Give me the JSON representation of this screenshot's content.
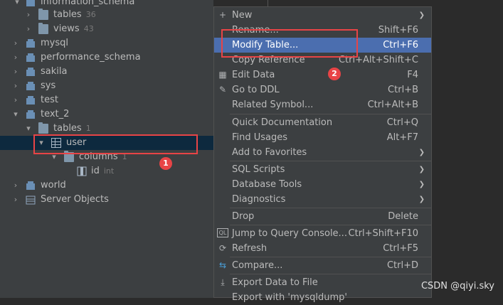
{
  "tree": {
    "items": [
      {
        "label": "information_schema",
        "count": ""
      },
      {
        "label": "tables",
        "count": "36"
      },
      {
        "label": "views",
        "count": "43"
      },
      {
        "label": "mysql",
        "count": ""
      },
      {
        "label": "performance_schema",
        "count": ""
      },
      {
        "label": "sakila",
        "count": ""
      },
      {
        "label": "sys",
        "count": ""
      },
      {
        "label": "test",
        "count": ""
      },
      {
        "label": "text_2",
        "count": ""
      },
      {
        "label": "tables",
        "count": "1"
      },
      {
        "label": "user",
        "count": ""
      },
      {
        "label": "columns",
        "count": "1"
      },
      {
        "label": "id",
        "count": "int"
      },
      {
        "label": "world",
        "count": ""
      },
      {
        "label": "Server Objects",
        "count": ""
      }
    ]
  },
  "menu": {
    "items": [
      {
        "label": "New",
        "shortcut": "",
        "icon": "plus-icon",
        "glyph": "+"
      },
      {
        "label": "Rename...",
        "shortcut": "Shift+F6",
        "icon": "",
        "glyph": ""
      },
      {
        "label": "Modify Table...",
        "shortcut": "Ctrl+F6",
        "icon": "",
        "glyph": ""
      },
      {
        "label": "Copy Reference",
        "shortcut": "Ctrl+Alt+Shift+C",
        "icon": "",
        "glyph": ""
      },
      {
        "label": "Edit Data",
        "shortcut": "F4",
        "icon": "grid-icon",
        "glyph": "▦"
      },
      {
        "label": "Go to DDL",
        "shortcut": "Ctrl+B",
        "icon": "pencil-icon",
        "glyph": "✎"
      },
      {
        "label": "Related Symbol...",
        "shortcut": "Ctrl+Alt+B",
        "icon": "",
        "glyph": ""
      },
      {
        "label": "Quick Documentation",
        "shortcut": "Ctrl+Q",
        "icon": "",
        "glyph": ""
      },
      {
        "label": "Find Usages",
        "shortcut": "Alt+F7",
        "icon": "",
        "glyph": ""
      },
      {
        "label": "Add to Favorites",
        "shortcut": "",
        "icon": "",
        "glyph": ""
      },
      {
        "label": "SQL Scripts",
        "shortcut": "",
        "icon": "",
        "glyph": ""
      },
      {
        "label": "Database Tools",
        "shortcut": "",
        "icon": "",
        "glyph": ""
      },
      {
        "label": "Diagnostics",
        "shortcut": "",
        "icon": "",
        "glyph": ""
      },
      {
        "label": "Drop",
        "shortcut": "Delete",
        "icon": "",
        "glyph": ""
      },
      {
        "label": "Jump to Query Console...",
        "shortcut": "Ctrl+Shift+F10",
        "icon": "console-icon",
        "glyph": "QL"
      },
      {
        "label": "Refresh",
        "shortcut": "Ctrl+F5",
        "icon": "refresh-icon",
        "glyph": "⟳"
      },
      {
        "label": "Compare...",
        "shortcut": "Ctrl+D",
        "icon": "compare-icon",
        "glyph": "⇆"
      },
      {
        "label": "Export Data to File",
        "shortcut": "",
        "icon": "export-icon",
        "glyph": "⤓"
      },
      {
        "label": "Export with 'mysqldump'",
        "shortcut": "",
        "icon": "",
        "glyph": ""
      }
    ]
  },
  "annotations": {
    "badge_1": "1",
    "badge_2": "2"
  },
  "watermark": "CSDN @qiyi.sky",
  "colors": {
    "highlight": "#4b6eaf",
    "annotation": "#e84446",
    "selection": "#0d293e"
  }
}
